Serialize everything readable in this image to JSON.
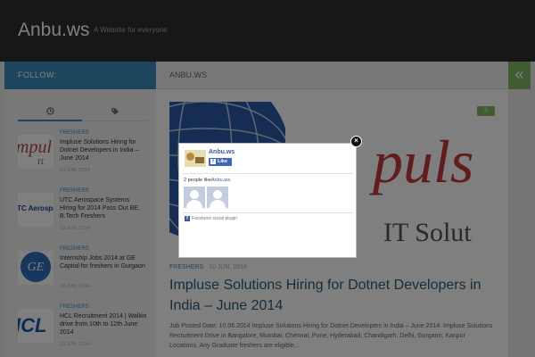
{
  "header": {
    "site_title": "Anbu.ws",
    "tagline": "A Website for everyone"
  },
  "nav": {
    "sidebar_label": "FOLLOW:",
    "content_label": "ANBU.WS",
    "collapse_icon": "double-chevron-left-icon"
  },
  "sidebar": {
    "tabs": [
      {
        "icon": "clock-icon"
      },
      {
        "icon": "tags-icon"
      }
    ],
    "posts": [
      {
        "category": "FRESHERS",
        "title": "Impluse Solutions Hiring for Dotnet Developers in India – June 2014",
        "date": "10 JUN, 2014",
        "thumb_text": "mpul",
        "thumb_sub": "IT"
      },
      {
        "category": "FRESHERS",
        "title": "UTC Aerospace Systems Hiring for 2014 Pass Out BE, B.Tech Freshers",
        "date": "10 JUN, 2014",
        "thumb_text": "TC Aerospace S"
      },
      {
        "category": "FRESHERS",
        "title": "Internship Jobs 2014 at GE Capital for freshers in Gurgaon",
        "date": "10 JUN, 2014",
        "thumb_text": "GE"
      },
      {
        "category": "FRESHERS",
        "title": "HCL Recruitment 2014 | Walkin drive from 10th to 12th June 2014",
        "date": "10 JUN, 2014",
        "thumb_text": "ICL"
      }
    ]
  },
  "main": {
    "comment_count": "0",
    "featured_text": "puls",
    "featured_sub": "IT Solut",
    "category": "FRESHERS",
    "date": "10 JUN, 2014",
    "title": "Impluse Solutions Hiring for Dotnet Developers in India – June 2014",
    "excerpt": "Job Posted Date: 10.06.2014 Impluse Solutions Hiring for Dotnet Developers in India – June 2014. Impluse Solutions Recruitment Drive in Bangalore, Mumbai, Chennai, Pune, Hyderabad, Chandigarh, Delhi, Gurgaon, Kanpur Locations. Any Graduate freshers are eligible..."
  },
  "popup": {
    "page_name": "Anbu.ws",
    "like_label": "Like",
    "count_text": "2 people like",
    "count_link": "Anbu.ws",
    "count_suffix": ".",
    "plugin_label": "Facebook social plugin"
  },
  "colors": {
    "accent_blue": "#3b8dbd",
    "accent_green": "#82b965",
    "facebook_blue": "#3b5998",
    "header_dark": "#2f2f33"
  }
}
